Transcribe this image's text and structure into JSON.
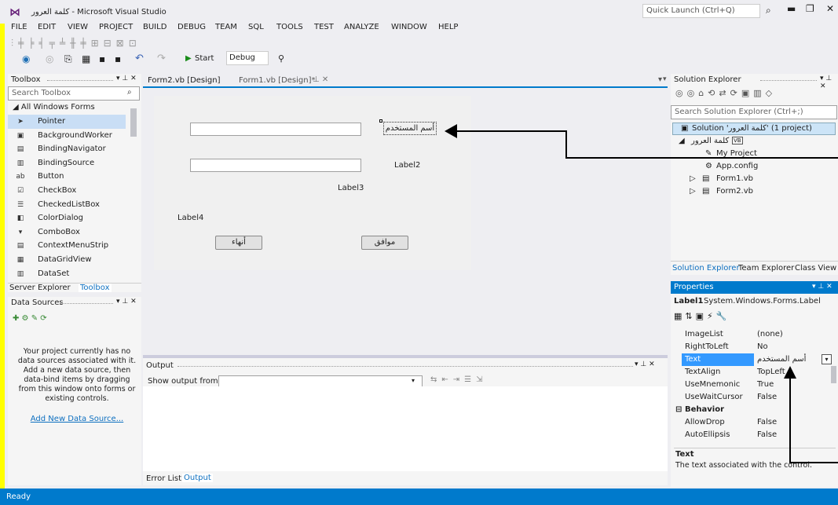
{
  "window": {
    "title": "كلمة العرور - Microsoft Visual Studio",
    "quick_launch": "Quick Launch (Ctrl+Q)"
  },
  "menu": [
    "FILE",
    "EDIT",
    "VIEW",
    "PROJECT",
    "BUILD",
    "DEBUG",
    "TEAM",
    "SQL",
    "TOOLS",
    "TEST",
    "ANALYZE",
    "WINDOW",
    "HELP"
  ],
  "toolbar": {
    "start": "Start",
    "config": "Debug"
  },
  "toolbox": {
    "title": "Toolbox",
    "search": "Search Toolbox",
    "group": "◢ All Windows Forms",
    "items": [
      "Pointer",
      "BackgroundWorker",
      "BindingNavigator",
      "BindingSource",
      "Button",
      "CheckBox",
      "CheckedListBox",
      "ColorDialog",
      "ComboBox",
      "ContextMenuStrip",
      "DataGridView",
      "DataSet"
    ],
    "icons": [
      "➤",
      "▣",
      "▤",
      "▥",
      "ab",
      "☑",
      "☰",
      "◧",
      "▾",
      "▤",
      "▦",
      "▥"
    ],
    "tabs": [
      "Server Explorer",
      "Toolbox"
    ]
  },
  "datasources": {
    "title": "Data Sources",
    "message": "Your project currently has no data sources associated with it. Add a new data source, then data-bind items by dragging from this window onto forms or existing controls.",
    "link": "Add New Data Source..."
  },
  "doc_tabs": [
    "Form2.vb [Design]",
    "Form1.vb [Design]*"
  ],
  "form": {
    "label_user": "أسم المستخدم",
    "label2": "Label2",
    "label3": "Label3",
    "label4": "Label4",
    "btn_cancel": "أنهاء",
    "btn_ok": "موافق"
  },
  "output": {
    "title": "Output",
    "show_from": "Show output from:",
    "tabs": [
      "Error List",
      "Output"
    ]
  },
  "solution": {
    "title": "Solution Explorer",
    "search": "Search Solution Explorer (Ctrl+;)",
    "root": "Solution 'كلمة العرور' (1 project)",
    "project": "كلمة العرور",
    "items": [
      "My Project",
      "App.config",
      "Form1.vb",
      "Form2.vb"
    ],
    "tabs": [
      "Solution Explorer",
      "Team Explorer",
      "Class View"
    ]
  },
  "properties": {
    "title": "Properties",
    "object": "Label1",
    "object_type": "System.Windows.Forms.Label",
    "rows": [
      {
        "k": "ImageList",
        "v": "(none)"
      },
      {
        "k": "RightToLeft",
        "v": "No"
      },
      {
        "k": "Text",
        "v": "أسم المستخدم"
      },
      {
        "k": "TextAlign",
        "v": "TopLeft"
      },
      {
        "k": "UseMnemonic",
        "v": "True"
      },
      {
        "k": "UseWaitCursor",
        "v": "False"
      }
    ],
    "category": "Behavior",
    "rows2": [
      {
        "k": "AllowDrop",
        "v": "False"
      },
      {
        "k": "AutoEllipsis",
        "v": "False"
      }
    ],
    "desc_title": "Text",
    "desc": "The text associated with the control."
  },
  "status": "Ready"
}
